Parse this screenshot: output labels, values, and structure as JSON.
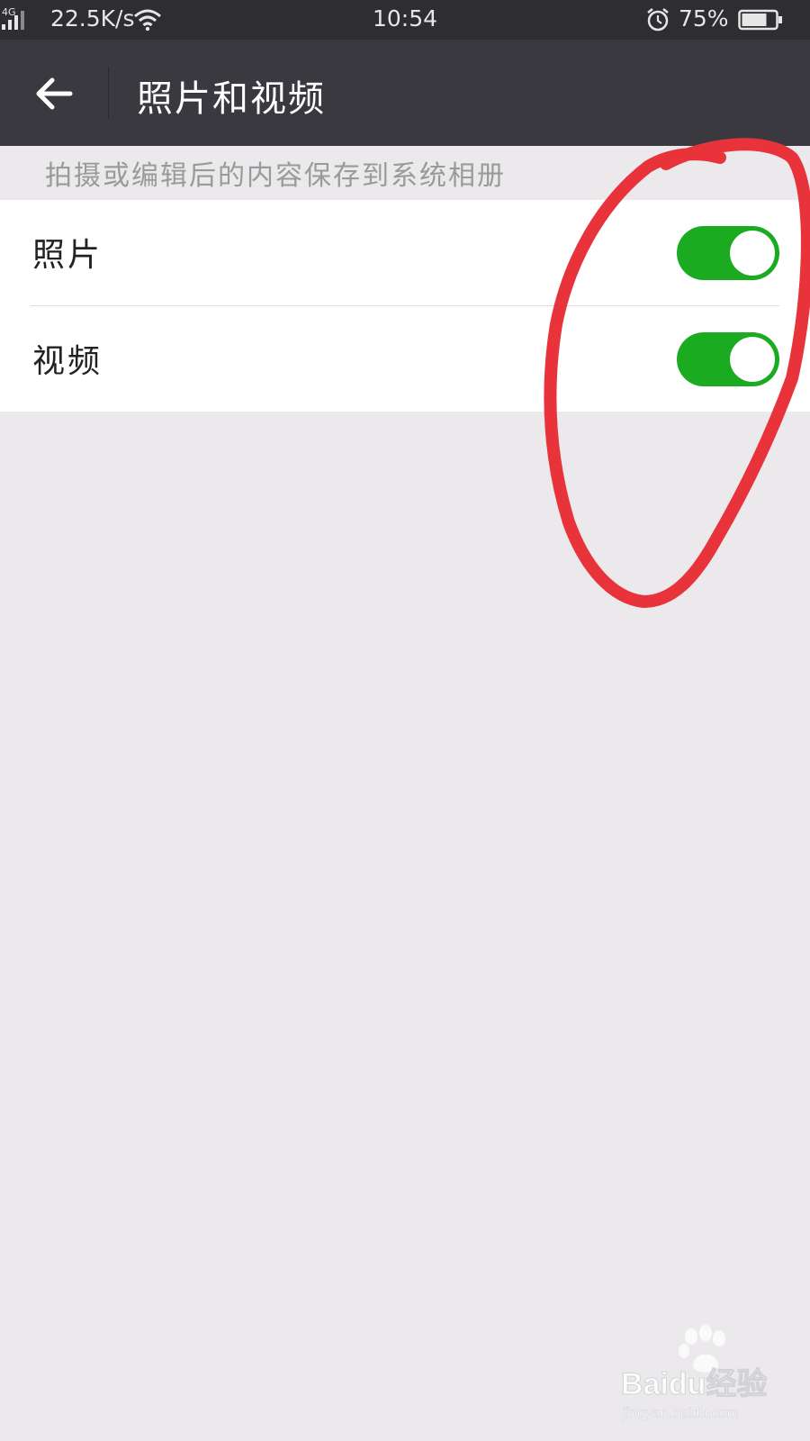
{
  "status_bar": {
    "network_type": "4G",
    "net_speed": "22.5K/s",
    "time": "10:54",
    "battery_percent": "75%",
    "battery_level": 0.75
  },
  "app_bar": {
    "title": "照片和视频",
    "back_icon": "arrow-left-icon"
  },
  "section": {
    "hint": "拍摄或编辑后的内容保存到系统相册"
  },
  "settings": [
    {
      "label": "照片",
      "enabled": true
    },
    {
      "label": "视频",
      "enabled": true
    }
  ],
  "colors": {
    "toggle_on": "#1aab21",
    "app_bar": "#39393f",
    "status_bar": "#2e2e32",
    "background": "#ebe9ec",
    "annotation": "#e8333a"
  },
  "watermark": {
    "brand_text": "Baidu经验",
    "url": "jingyan.baidu.com"
  }
}
